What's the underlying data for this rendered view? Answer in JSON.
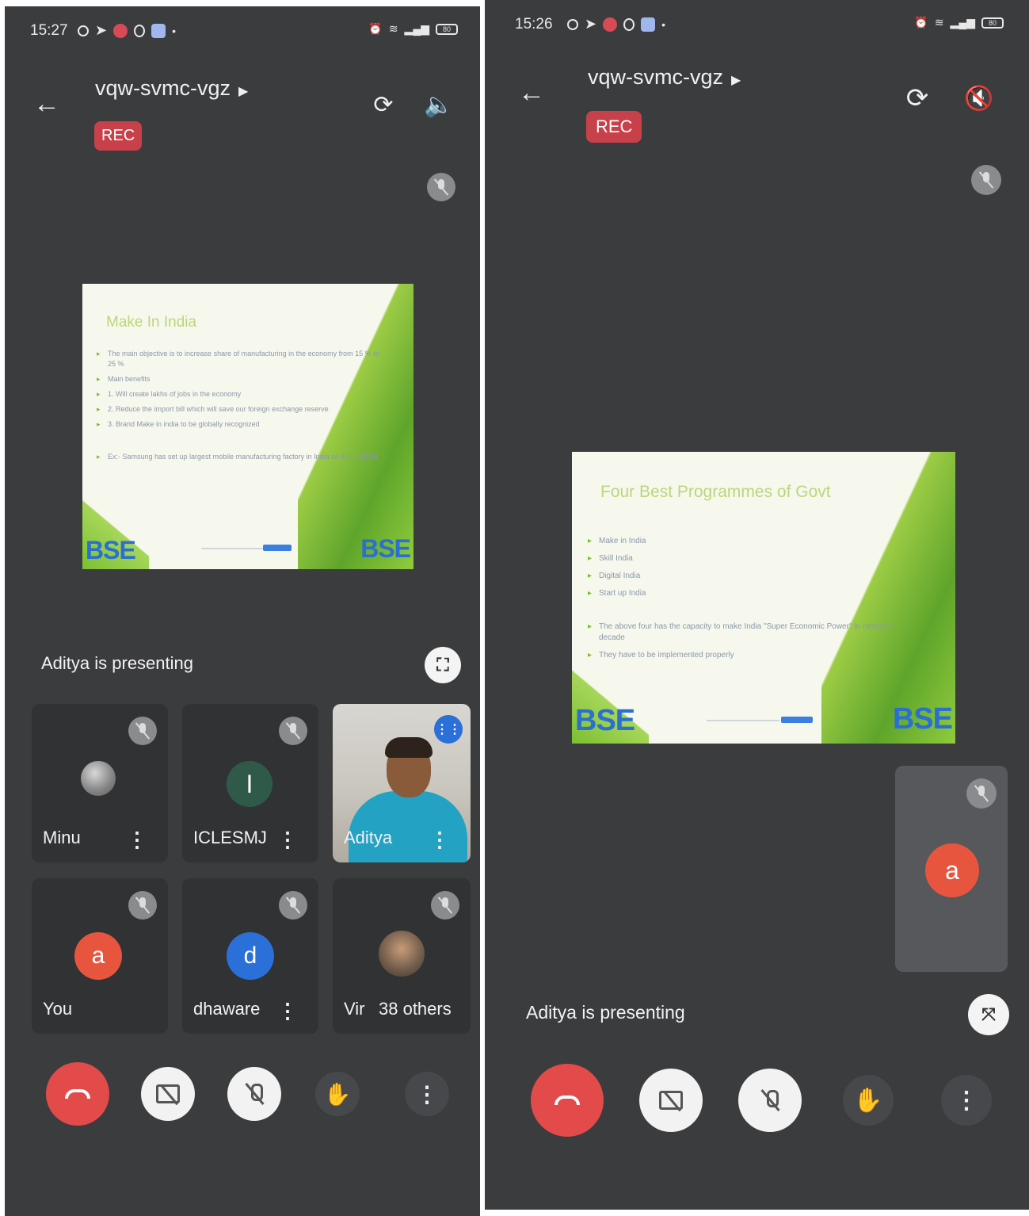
{
  "left": {
    "status": {
      "time": "15:27",
      "battery": "80"
    },
    "meeting_code": "vqw-svmc-vgz",
    "rec_label": "REC",
    "slide": {
      "title": "Make In India",
      "bullets": [
        "The main objective is to increase share of manufacturing in the economy from 15 % to 25 %",
        "Main benefits",
        "1. Will create lakhs of jobs in the economy",
        "2. Reduce the import bill which will save our foreign exchange reserve",
        "3. Brand Make in india to be globally recognized",
        "Ex:- Samsung has set up largest mobile manufacturing factory in India on 9 July 2018"
      ],
      "logo_left": "BSE",
      "logo_right": "BSE"
    },
    "presenting_text": "Aditya is presenting",
    "participants": [
      {
        "name": "Minu",
        "initial": ""
      },
      {
        "name": "ICLESMJ",
        "initial": "I"
      },
      {
        "name": "Aditya",
        "initial": ""
      },
      {
        "name": "You",
        "initial": "a"
      },
      {
        "name": "dhaware",
        "initial": "d"
      },
      {
        "name": "Vir",
        "initial": ""
      }
    ],
    "others_label": "38 others"
  },
  "right": {
    "status": {
      "time": "15:26",
      "battery": "80"
    },
    "meeting_code": "vqw-svmc-vgz",
    "rec_label": "REC",
    "slide": {
      "title": "Four Best Programmes of Govt",
      "bullets": [
        "Make in India",
        "Skill India",
        "Digital India",
        "Start up India",
        "The above four has the capacity to make India \"Super Economic Power\" in next one decade",
        "They have to be implemented properly"
      ],
      "logo_left": "BSE",
      "logo_right": "BSE"
    },
    "self_initial": "a",
    "presenting_text": "Aditya is presenting"
  },
  "colors": {
    "background": "#3b3c3e",
    "rec": "#c8404a",
    "end_call": "#e34a4a",
    "avatar_orange": "#e8553e",
    "avatar_blue": "#2b6fd8",
    "avatar_green": "#2f5a4a"
  },
  "icons": [
    "back-arrow-icon",
    "switch-camera-icon",
    "speaker-icon",
    "speaker-off-icon",
    "mic-off-icon",
    "fullscreen-icon",
    "exit-fullscreen-icon",
    "end-call-icon",
    "camera-off-icon",
    "raise-hand-icon",
    "more-icon",
    "speaking-icon"
  ]
}
